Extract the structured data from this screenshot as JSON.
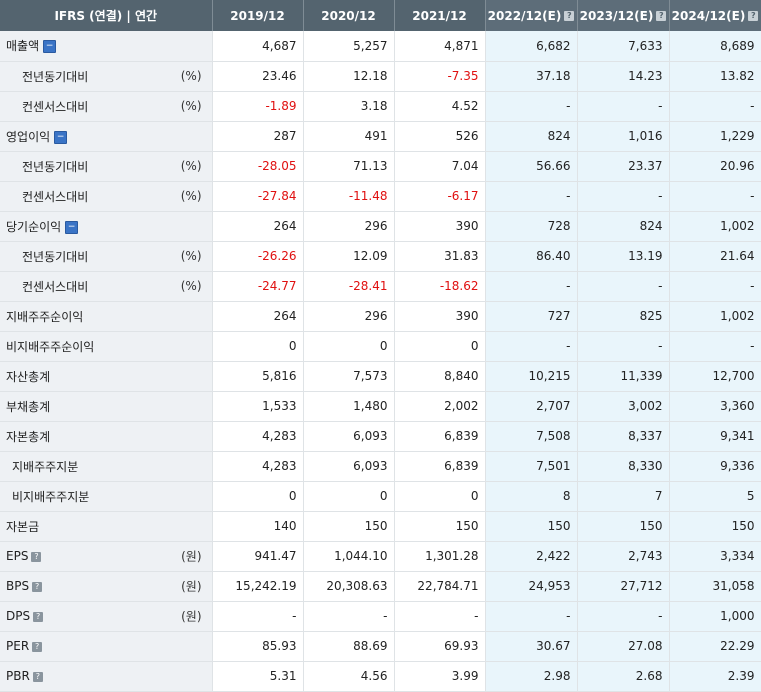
{
  "header": {
    "title": "IFRS (연결) | 연간",
    "years": [
      "2019/12",
      "2020/12",
      "2021/12",
      "2022/12(E)",
      "2023/12(E)",
      "2024/12(E)"
    ]
  },
  "rows": [
    {
      "label": "매출액",
      "unit": "",
      "toggle": true,
      "info": false,
      "indent": 0,
      "values": [
        "4,687",
        "5,257",
        "4,871",
        "6,682",
        "7,633",
        "8,689"
      ]
    },
    {
      "label": "전년동기대비",
      "unit": "(%)",
      "toggle": false,
      "info": false,
      "indent": 1,
      "values": [
        "23.46",
        "12.18",
        "-7.35",
        "37.18",
        "14.23",
        "13.82"
      ]
    },
    {
      "label": "컨센서스대비",
      "unit": "(%)",
      "toggle": false,
      "info": false,
      "indent": 1,
      "values": [
        "-1.89",
        "3.18",
        "4.52",
        "-",
        "-",
        "-"
      ]
    },
    {
      "label": "영업이익",
      "unit": "",
      "toggle": true,
      "info": false,
      "indent": 0,
      "values": [
        "287",
        "491",
        "526",
        "824",
        "1,016",
        "1,229"
      ]
    },
    {
      "label": "전년동기대비",
      "unit": "(%)",
      "toggle": false,
      "info": false,
      "indent": 1,
      "values": [
        "-28.05",
        "71.13",
        "7.04",
        "56.66",
        "23.37",
        "20.96"
      ]
    },
    {
      "label": "컨센서스대비",
      "unit": "(%)",
      "toggle": false,
      "info": false,
      "indent": 1,
      "values": [
        "-27.84",
        "-11.48",
        "-6.17",
        "-",
        "-",
        "-"
      ]
    },
    {
      "label": "당기순이익",
      "unit": "",
      "toggle": true,
      "info": false,
      "indent": 0,
      "values": [
        "264",
        "296",
        "390",
        "728",
        "824",
        "1,002"
      ]
    },
    {
      "label": "전년동기대비",
      "unit": "(%)",
      "toggle": false,
      "info": false,
      "indent": 1,
      "values": [
        "-26.26",
        "12.09",
        "31.83",
        "86.40",
        "13.19",
        "21.64"
      ]
    },
    {
      "label": "컨센서스대비",
      "unit": "(%)",
      "toggle": false,
      "info": false,
      "indent": 1,
      "values": [
        "-24.77",
        "-28.41",
        "-18.62",
        "-",
        "-",
        "-"
      ]
    },
    {
      "label": "지배주주순이익",
      "unit": "",
      "toggle": false,
      "info": false,
      "indent": 0,
      "values": [
        "264",
        "296",
        "390",
        "727",
        "825",
        "1,002"
      ]
    },
    {
      "label": "비지배주주순이익",
      "unit": "",
      "toggle": false,
      "info": false,
      "indent": 0,
      "values": [
        "0",
        "0",
        "0",
        "-",
        "-",
        "-"
      ]
    },
    {
      "label": "자산총계",
      "unit": "",
      "toggle": false,
      "info": false,
      "indent": 0,
      "values": [
        "5,816",
        "7,573",
        "8,840",
        "10,215",
        "11,339",
        "12,700"
      ]
    },
    {
      "label": "부채총계",
      "unit": "",
      "toggle": false,
      "info": false,
      "indent": 0,
      "values": [
        "1,533",
        "1,480",
        "2,002",
        "2,707",
        "3,002",
        "3,360"
      ]
    },
    {
      "label": "자본총계",
      "unit": "",
      "toggle": false,
      "info": false,
      "indent": 0,
      "values": [
        "4,283",
        "6,093",
        "6,839",
        "7,508",
        "8,337",
        "9,341"
      ]
    },
    {
      "label": "지배주주지분",
      "unit": "",
      "toggle": false,
      "info": false,
      "indent": 2,
      "values": [
        "4,283",
        "6,093",
        "6,839",
        "7,501",
        "8,330",
        "9,336"
      ]
    },
    {
      "label": "비지배주주지분",
      "unit": "",
      "toggle": false,
      "info": false,
      "indent": 2,
      "values": [
        "0",
        "0",
        "0",
        "8",
        "7",
        "5"
      ]
    },
    {
      "label": "자본금",
      "unit": "",
      "toggle": false,
      "info": false,
      "indent": 0,
      "values": [
        "140",
        "150",
        "150",
        "150",
        "150",
        "150"
      ]
    },
    {
      "label": "EPS",
      "unit": "(원)",
      "toggle": false,
      "info": true,
      "indent": 0,
      "values": [
        "941.47",
        "1,044.10",
        "1,301.28",
        "2,422",
        "2,743",
        "3,334"
      ]
    },
    {
      "label": "BPS",
      "unit": "(원)",
      "toggle": false,
      "info": true,
      "indent": 0,
      "values": [
        "15,242.19",
        "20,308.63",
        "22,784.71",
        "24,953",
        "27,712",
        "31,058"
      ]
    },
    {
      "label": "DPS",
      "unit": "(원)",
      "toggle": false,
      "info": true,
      "indent": 0,
      "values": [
        "-",
        "-",
        "-",
        "-",
        "-",
        "1,000"
      ]
    },
    {
      "label": "PER",
      "unit": "",
      "toggle": false,
      "info": true,
      "indent": 0,
      "values": [
        "85.93",
        "88.69",
        "69.93",
        "30.67",
        "27.08",
        "22.29"
      ]
    },
    {
      "label": "PBR",
      "unit": "",
      "toggle": false,
      "info": true,
      "indent": 0,
      "values": [
        "5.31",
        "4.56",
        "3.99",
        "2.98",
        "2.68",
        "2.39"
      ]
    }
  ],
  "colors": {
    "header_bg": "#54646f",
    "label_bg": "#eef1f4",
    "forecast_bg": "#e9f5fb",
    "negative": "#e01010"
  }
}
